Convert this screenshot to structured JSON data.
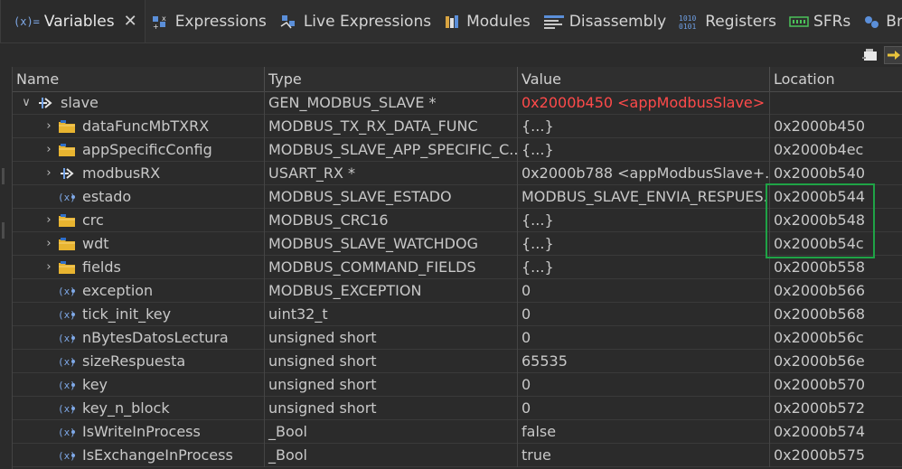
{
  "tabs": [
    {
      "id": "variables",
      "label": "Variables",
      "icon": "variables-icon",
      "active": true
    },
    {
      "id": "expressions",
      "label": "Expressions",
      "icon": "expressions-icon"
    },
    {
      "id": "live-expressions",
      "label": "Live Expressions",
      "icon": "live-expressions-icon"
    },
    {
      "id": "modules",
      "label": "Modules",
      "icon": "modules-icon"
    },
    {
      "id": "disassembly",
      "label": "Disassembly",
      "icon": "disassembly-icon"
    },
    {
      "id": "registers",
      "label": "Registers",
      "icon": "registers-icon"
    },
    {
      "id": "sfrs",
      "label": "SFRs",
      "icon": "sfrs-icon"
    },
    {
      "id": "breakpoints",
      "label": "Breakp",
      "icon": "breakpoints-icon"
    }
  ],
  "variables_icon_text": "(x)=",
  "columns": {
    "name": "Name",
    "type": "Type",
    "value": "Value",
    "location": "Location"
  },
  "rows": [
    {
      "name": "slave",
      "type": "GEN_MODBUS_SLAVE *",
      "value": "0x2000b450 <appModbusSlave>",
      "location": "",
      "twisty": "expanded",
      "icon": "pointer-icon",
      "value_changed": true
    },
    {
      "name": "dataFuncMbTXRX",
      "type": "MODBUS_TX_RX_DATA_FUNC",
      "value": "{...}",
      "location": "0x2000b450",
      "twisty": "collapsed",
      "icon": "struct-folder-icon"
    },
    {
      "name": "appSpecificConfig",
      "type": "MODBUS_SLAVE_APP_SPECIFIC_C...",
      "value": "{...}",
      "location": "0x2000b4ec",
      "twisty": "collapsed",
      "icon": "struct-folder-icon"
    },
    {
      "name": "modbusRX",
      "type": "USART_RX *",
      "value": "0x2000b788 <appModbusSlave+...",
      "location": "0x2000b540",
      "twisty": "collapsed",
      "icon": "pointer-icon"
    },
    {
      "name": "estado",
      "type": "MODBUS_SLAVE_ESTADO",
      "value": "MODBUS_SLAVE_ENVIA_RESPUES...",
      "location": "0x2000b544",
      "twisty": "none",
      "icon": "variable-icon"
    },
    {
      "name": "crc",
      "type": "MODBUS_CRC16",
      "value": "{...}",
      "location": "0x2000b548",
      "twisty": "collapsed",
      "icon": "struct-folder-icon"
    },
    {
      "name": "wdt",
      "type": "MODBUS_SLAVE_WATCHDOG",
      "value": "{...}",
      "location": "0x2000b54c",
      "twisty": "collapsed",
      "icon": "struct-folder-icon"
    },
    {
      "name": "fields",
      "type": "MODBUS_COMMAND_FIELDS",
      "value": "{...}",
      "location": "0x2000b558",
      "twisty": "collapsed",
      "icon": "struct-folder-icon"
    },
    {
      "name": "exception",
      "type": "MODBUS_EXCEPTION",
      "value": "0",
      "location": "0x2000b566",
      "twisty": "none",
      "icon": "variable-icon"
    },
    {
      "name": "tick_init_key",
      "type": "uint32_t",
      "value": "0",
      "location": "0x2000b568",
      "twisty": "none",
      "icon": "variable-icon"
    },
    {
      "name": "nBytesDatosLectura",
      "type": "unsigned short",
      "value": "0",
      "location": "0x2000b56c",
      "twisty": "none",
      "icon": "variable-icon"
    },
    {
      "name": "sizeRespuesta",
      "type": "unsigned short",
      "value": "65535",
      "location": "0x2000b56e",
      "twisty": "none",
      "icon": "variable-icon"
    },
    {
      "name": "key",
      "type": "unsigned short",
      "value": "0",
      "location": "0x2000b570",
      "twisty": "none",
      "icon": "variable-icon"
    },
    {
      "name": "key_n_block",
      "type": "unsigned short",
      "value": "0",
      "location": "0x2000b572",
      "twisty": "none",
      "icon": "variable-icon"
    },
    {
      "name": "IsWriteInProcess",
      "type": "_Bool",
      "value": "false",
      "location": "0x2000b574",
      "twisty": "none",
      "icon": "variable-icon"
    },
    {
      "name": "IsExchangeInProcess",
      "type": "_Bool",
      "value": "true",
      "location": "0x2000b575",
      "twisty": "none",
      "icon": "variable-icon"
    }
  ],
  "colors": {
    "changed_value": "#ff4a4a",
    "highlight_box": "#1fa346",
    "background": "#2b2b2b"
  }
}
